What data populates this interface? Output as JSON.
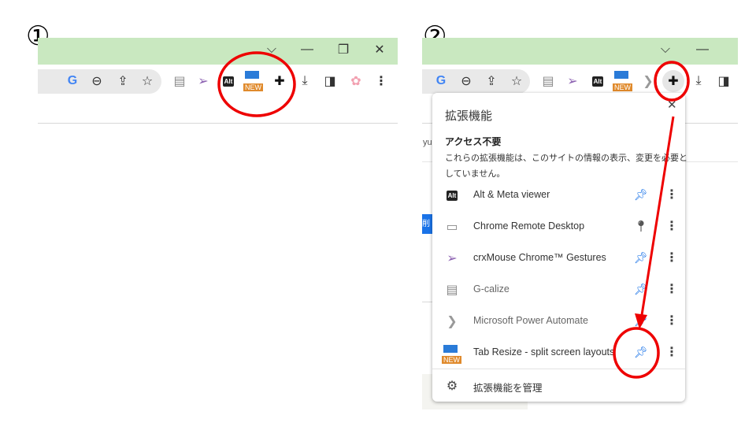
{
  "steps": {
    "one": "①",
    "two": "②"
  },
  "window_controls": {
    "dropdown": "⌵",
    "minimize": "—",
    "maximize": "❐",
    "close": "✕"
  },
  "toolbar": {
    "new_badge": "NEW",
    "alt_label": "Alt",
    "menu": "⋮"
  },
  "popup": {
    "title": "拡張機能",
    "close": "✕",
    "section_title": "アクセス不要",
    "section_desc_1": "これらの拡張機能は、このサイトの情報の表示、変更を必要と",
    "section_desc_2": "していません。",
    "items": [
      {
        "name": "Alt & Meta viewer",
        "pinned": true
      },
      {
        "name": "Chrome Remote Desktop",
        "pinned": false
      },
      {
        "name": "crxMouse Chrome™ Gestures",
        "pinned": true
      },
      {
        "name": "G-calize",
        "pinned": true
      },
      {
        "name": "Microsoft Power Automate",
        "pinned": true
      },
      {
        "name": "Tab Resize - split screen layouts",
        "pinned": true
      }
    ],
    "manage": "拡張機能を管理"
  },
  "background": {
    "partial_text": "yu",
    "partial_button": "削除"
  },
  "colors": {
    "titlebar": "#c9e8c0",
    "pin_active": "#1a73e8",
    "annotation": "#ee0000",
    "new_badge": "#e08a2c"
  }
}
